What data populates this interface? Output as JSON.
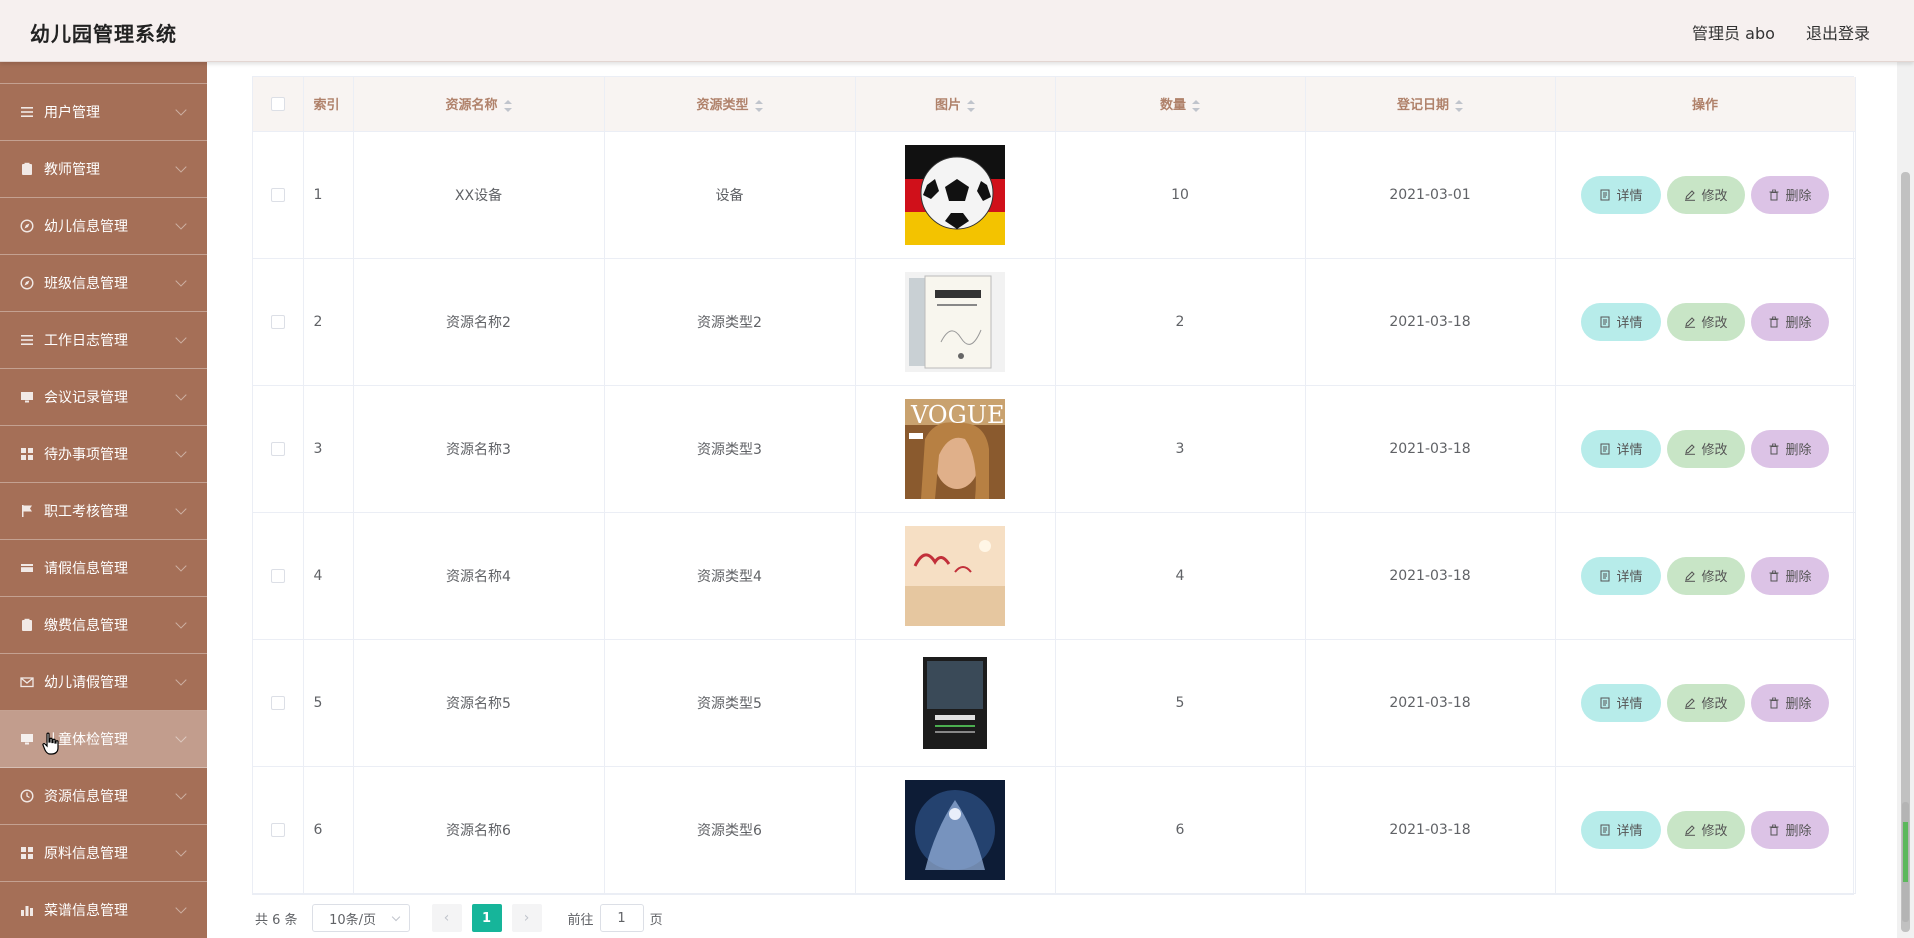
{
  "header": {
    "title": "幼儿园管理系统",
    "admin": "管理员 abo",
    "logout": "退出登录"
  },
  "sidebar": {
    "items": [
      {
        "label": "用户管理",
        "icon": "list-icon"
      },
      {
        "label": "教师管理",
        "icon": "clipboard-icon"
      },
      {
        "label": "幼儿信息管理",
        "icon": "compass-icon"
      },
      {
        "label": "班级信息管理",
        "icon": "compass-icon"
      },
      {
        "label": "工作日志管理",
        "icon": "list-icon"
      },
      {
        "label": "会议记录管理",
        "icon": "monitor-icon"
      },
      {
        "label": "待办事项管理",
        "icon": "grid-icon"
      },
      {
        "label": "职工考核管理",
        "icon": "flag-icon"
      },
      {
        "label": "请假信息管理",
        "icon": "ticket-icon"
      },
      {
        "label": "缴费信息管理",
        "icon": "clipboard-icon"
      },
      {
        "label": "幼儿请假管理",
        "icon": "mail-icon"
      },
      {
        "label": "儿童体检管理",
        "icon": "monitor-icon"
      },
      {
        "label": "资源信息管理",
        "icon": "clock-icon"
      },
      {
        "label": "原料信息管理",
        "icon": "grid-icon"
      },
      {
        "label": "菜谱信息管理",
        "icon": "chart-icon"
      }
    ],
    "active_index": 11
  },
  "table": {
    "headers": {
      "index": "索引",
      "name": "资源名称",
      "type": "资源类型",
      "image": "图片",
      "quantity": "数量",
      "date": "登记日期",
      "actions": "操作"
    },
    "rows": [
      {
        "index": "1",
        "name": "XX设备",
        "type": "设备",
        "quantity": "10",
        "date": "2021-03-01",
        "image": "soccer-ball-image"
      },
      {
        "index": "2",
        "name": "资源名称2",
        "type": "资源类型2",
        "quantity": "2",
        "date": "2021-03-18",
        "image": "book-cover-image"
      },
      {
        "index": "3",
        "name": "资源名称3",
        "type": "资源类型3",
        "quantity": "3",
        "date": "2021-03-18",
        "image": "magazine-cover-image"
      },
      {
        "index": "4",
        "name": "资源名称4",
        "type": "资源类型4",
        "quantity": "4",
        "date": "2021-03-18",
        "image": "wheat-field-image"
      },
      {
        "index": "5",
        "name": "资源名称5",
        "type": "资源类型5",
        "quantity": "5",
        "date": "2021-03-18",
        "image": "training-book-image"
      },
      {
        "index": "6",
        "name": "资源名称6",
        "type": "资源类型6",
        "quantity": "6",
        "date": "2021-03-18",
        "image": "fantasy-art-image"
      }
    ],
    "actions": {
      "detail": "详情",
      "edit": "修改",
      "delete": "删除"
    }
  },
  "pagination": {
    "total": "共 6 条",
    "page_size": "10条/页",
    "current_page": "1",
    "goto_prefix": "前往",
    "goto_value": "1",
    "goto_suffix": "页"
  },
  "colors": {
    "sidebar_bg": "#a56f57",
    "sidebar_active": "#c29d8d",
    "header_bg": "#f6f0ef",
    "table_header_text": "#b0826b",
    "btn_detail": "#b7ecea",
    "btn_edit": "#c8e5c6",
    "btn_delete": "#dcc3e6",
    "pager_active": "#16b59a"
  }
}
